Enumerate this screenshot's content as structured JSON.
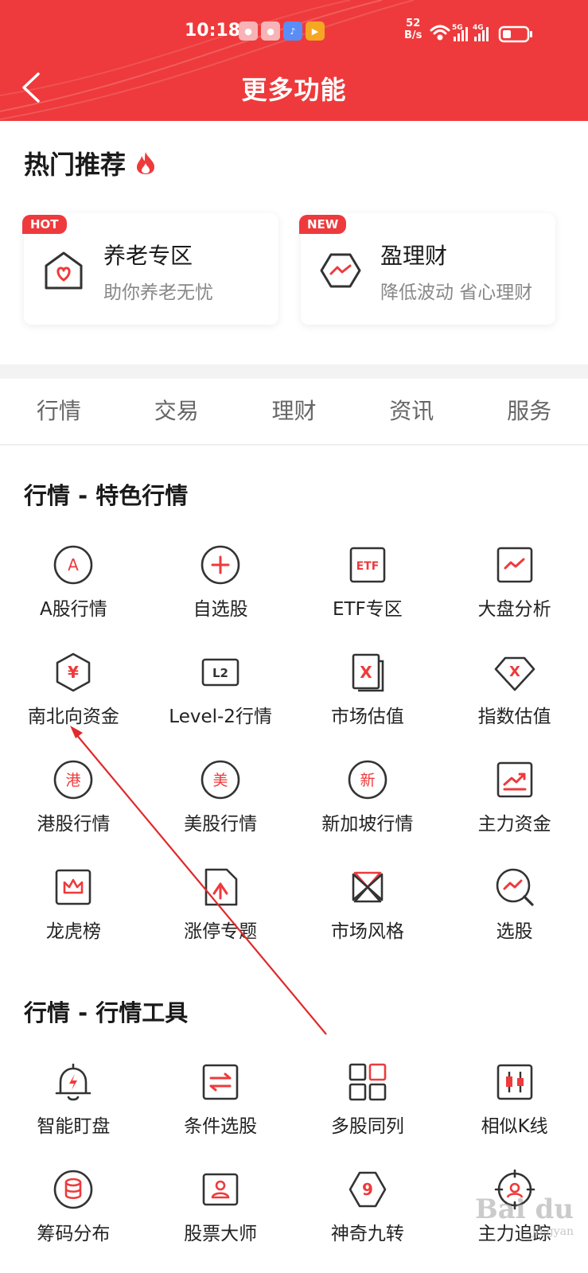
{
  "status_bar": {
    "time": "10:18",
    "net_speed_value": "52",
    "net_speed_unit": "B/s",
    "signal1": "5G",
    "signal2": "4G"
  },
  "header": {
    "title": "更多功能"
  },
  "hot": {
    "title": "热门推荐",
    "cards": [
      {
        "tag": "HOT",
        "name": "养老专区",
        "desc": "助你养老无忧"
      },
      {
        "tag": "NEW",
        "name": "盈理财",
        "desc": "降低波动 省心理财"
      }
    ]
  },
  "tabs": [
    "行情",
    "交易",
    "理财",
    "资讯",
    "服务"
  ],
  "section1": {
    "title": "行情 - 特色行情",
    "items": [
      {
        "label": "A股行情",
        "glyph": "A"
      },
      {
        "label": "自选股",
        "glyph": "+"
      },
      {
        "label": "ETF专区",
        "glyph": "ETF"
      },
      {
        "label": "大盘分析",
        "glyph": ""
      },
      {
        "label": "南北向资金",
        "glyph": "¥"
      },
      {
        "label": "Level-2行情",
        "glyph": "L2"
      },
      {
        "label": "市场估值",
        "glyph": "X"
      },
      {
        "label": "指数估值",
        "glyph": "X"
      },
      {
        "label": "港股行情",
        "glyph": "港"
      },
      {
        "label": "美股行情",
        "glyph": "美"
      },
      {
        "label": "新加坡行情",
        "glyph": "新"
      },
      {
        "label": "主力资金",
        "glyph": ""
      },
      {
        "label": "龙虎榜",
        "glyph": ""
      },
      {
        "label": "涨停专题",
        "glyph": ""
      },
      {
        "label": "市场风格",
        "glyph": ""
      },
      {
        "label": "选股",
        "glyph": ""
      }
    ]
  },
  "section2": {
    "title": "行情 - 行情工具",
    "items": [
      {
        "label": "智能盯盘",
        "glyph": ""
      },
      {
        "label": "条件选股",
        "glyph": ""
      },
      {
        "label": "多股同列",
        "glyph": ""
      },
      {
        "label": "相似K线",
        "glyph": ""
      },
      {
        "label": "筹码分布",
        "glyph": ""
      },
      {
        "label": "股票大师",
        "glyph": ""
      },
      {
        "label": "神奇九转",
        "glyph": "9"
      },
      {
        "label": "主力追踪",
        "glyph": ""
      }
    ]
  },
  "watermark": {
    "text": "Bai du",
    "sub": "jingyan"
  },
  "colors": {
    "brand": "#ee3a3c",
    "text": "#222222",
    "muted": "#888888"
  }
}
